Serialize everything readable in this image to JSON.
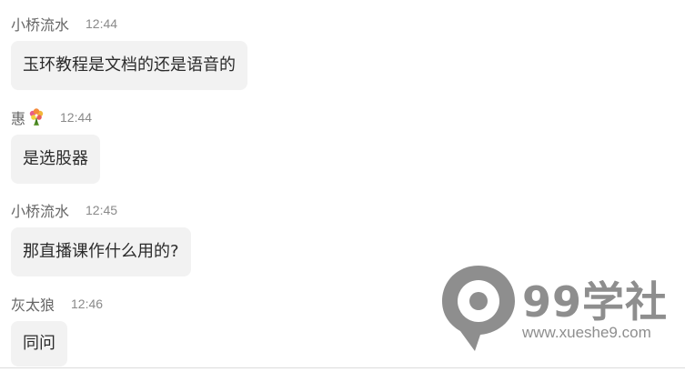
{
  "messages": [
    {
      "sender": "小桥流水",
      "time": "12:44",
      "text": "玉环教程是文档的还是语音的"
    },
    {
      "sender": "惠",
      "sender_icon": "flower-bouquet-icon",
      "time": "12:44",
      "text": "是选股器"
    },
    {
      "sender": "小桥流水",
      "time": "12:45",
      "text": "那直播课作什么用的?"
    },
    {
      "sender": "灰太狼",
      "time": "12:46",
      "text": "同问"
    }
  ],
  "watermark": {
    "brand": "99学社",
    "url": "www.xueshe9.com",
    "icon": "location-pin-logo-icon",
    "color": "#8e8e8e"
  },
  "colors": {
    "bubble_bg": "#f2f2f2",
    "sender_text": "#666666",
    "time_text": "#8a8a8a",
    "message_text": "#2b2b2b"
  }
}
